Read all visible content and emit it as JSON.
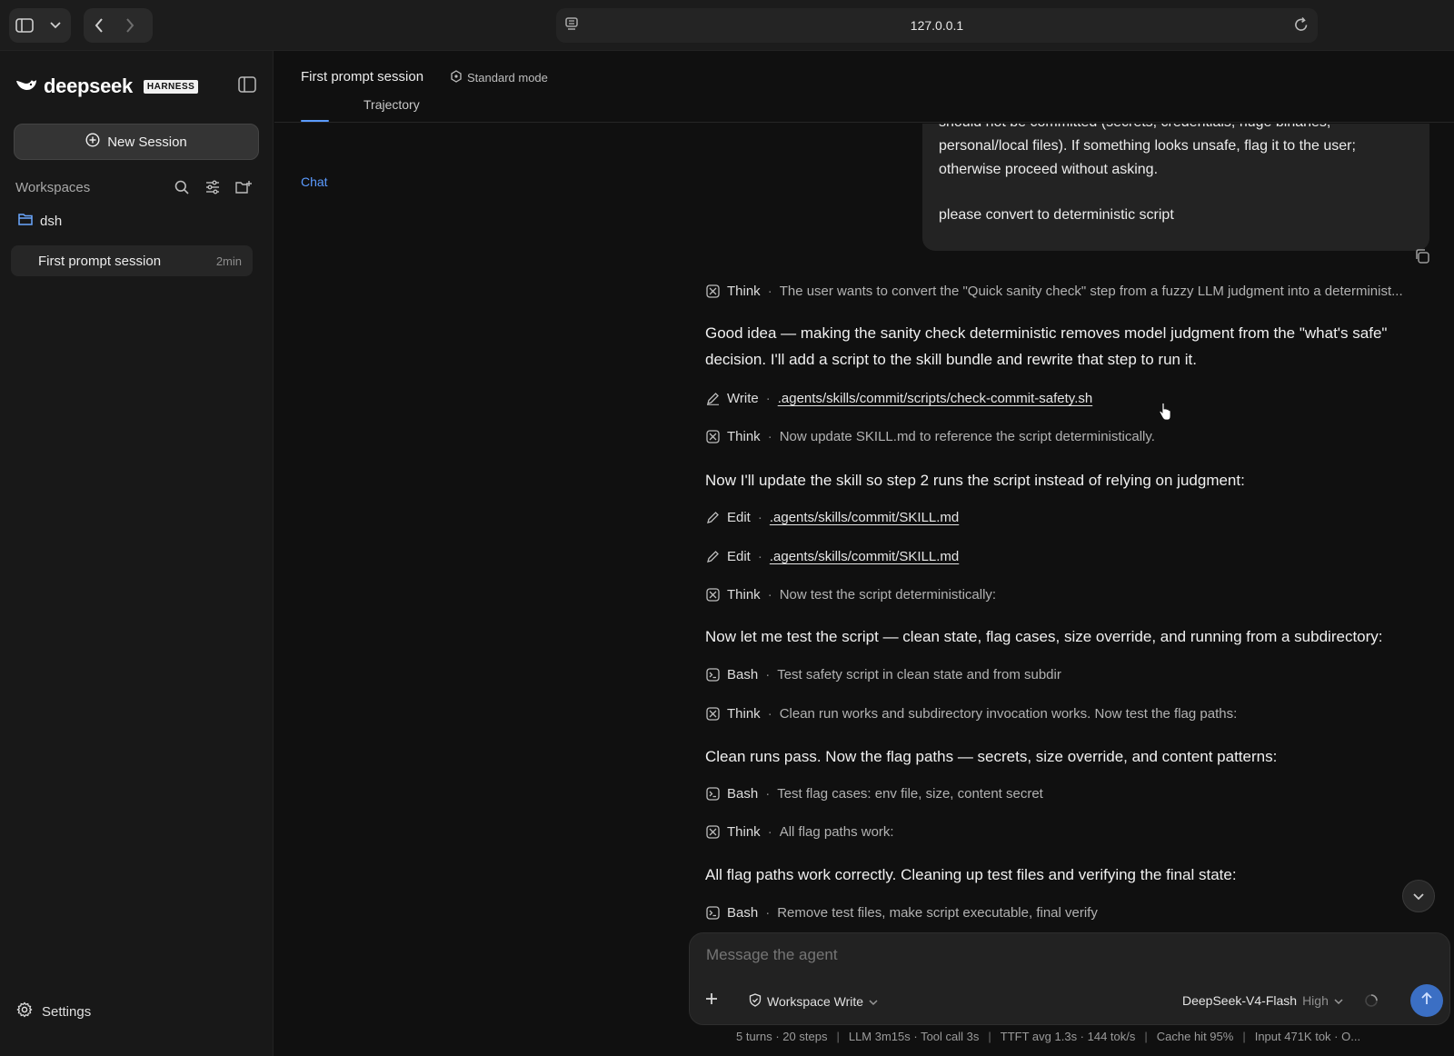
{
  "browser": {
    "url": "127.0.0.1"
  },
  "sidebar": {
    "brand": "deepseek",
    "brand_tag": "HARNESS",
    "new_session_label": "New Session",
    "workspaces_label": "Workspaces",
    "workspace": {
      "name": "dsh",
      "sessions": [
        {
          "name": "First prompt session",
          "time": "2min"
        }
      ]
    },
    "settings_label": "Settings"
  },
  "header": {
    "session_title": "First prompt session",
    "mode_label": "Standard mode",
    "tabs": [
      {
        "label": "Chat",
        "active": true
      },
      {
        "label": "Trajectory",
        "active": false
      }
    ]
  },
  "chat": {
    "user_message": {
      "partial_line": "should not be committed (secrets, credentials, huge binaries,",
      "text": "personal/local files). If something looks unsafe, flag it to the user; otherwise proceed without asking.",
      "request": "please convert to deterministic script"
    },
    "steps": [
      {
        "kind": "think",
        "label": "Think",
        "detail": "The user wants to convert the \"Quick sanity check\" step from a fuzzy LLM judgment into a determinist..."
      },
      {
        "kind": "text",
        "text": "Good idea — making the sanity check deterministic removes model judgment from the \"what's safe\" decision. I'll add a script to the skill bundle and rewrite that step to run it."
      },
      {
        "kind": "write",
        "label": "Write",
        "detail": ".agents/skills/commit/scripts/check-commit-safety.sh"
      },
      {
        "kind": "think",
        "label": "Think",
        "detail": "Now update SKILL.md to reference the script deterministically."
      },
      {
        "kind": "text",
        "text": "Now I'll update the skill so step 2 runs the script instead of relying on judgment:"
      },
      {
        "kind": "edit",
        "label": "Edit",
        "detail": ".agents/skills/commit/SKILL.md"
      },
      {
        "kind": "edit",
        "label": "Edit",
        "detail": ".agents/skills/commit/SKILL.md"
      },
      {
        "kind": "think",
        "label": "Think",
        "detail": "Now test the script deterministically:"
      },
      {
        "kind": "text",
        "text": "Now let me test the script — clean state, flag cases, size override, and running from a subdirectory:"
      },
      {
        "kind": "bash",
        "label": "Bash",
        "detail": "Test safety script in clean state and from subdir"
      },
      {
        "kind": "think",
        "label": "Think",
        "detail": "Clean run works and subdirectory invocation works. Now test the flag paths:"
      },
      {
        "kind": "text",
        "text": "Clean runs pass. Now the flag paths — secrets, size override, and content patterns:"
      },
      {
        "kind": "bash",
        "label": "Bash",
        "detail": "Test flag cases: env file, size, content secret"
      },
      {
        "kind": "think",
        "label": "Think",
        "detail": "All flag paths work:"
      },
      {
        "kind": "text",
        "text": "All flag paths work correctly. Cleaning up test files and verifying the final state:"
      },
      {
        "kind": "bash",
        "label": "Bash",
        "detail": "Remove test files, make script executable, final verify"
      }
    ]
  },
  "composer": {
    "placeholder": "Message the agent",
    "permission": "Workspace Write",
    "model": "DeepSeek-V4-Flash",
    "effort": "High"
  },
  "stats": {
    "turns": "5 turns · 20 steps",
    "timing": "LLM 3m15s · Tool call 3s",
    "ttft": "TTFT avg 1.3s · 144 tok/s",
    "cache": "Cache hit 95%",
    "input": "Input 471K tok · O..."
  }
}
